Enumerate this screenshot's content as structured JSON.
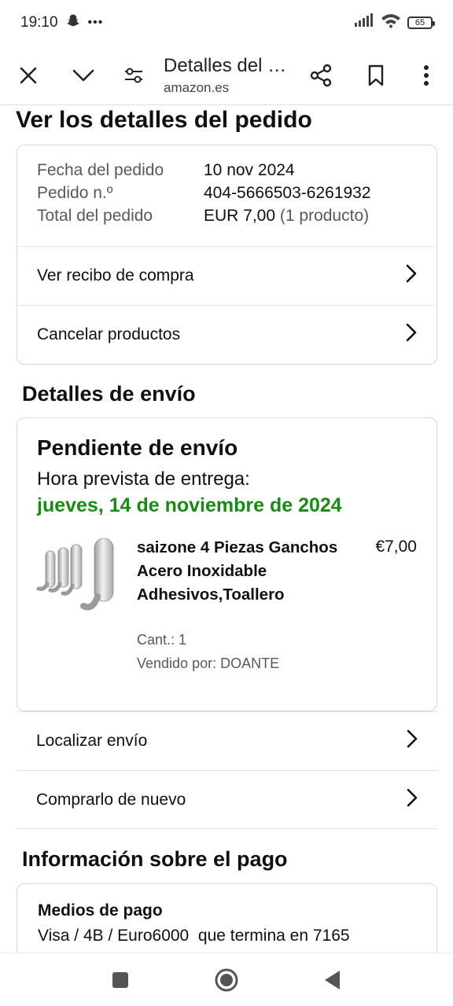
{
  "status_bar": {
    "time": "19:10",
    "dots": "•••",
    "battery": "65"
  },
  "toolbar": {
    "title": "Detalles del …",
    "url": "amazon.es"
  },
  "page": {
    "title": "Ver los detalles del pedido"
  },
  "order_summary": {
    "date_label": "Fecha del pedido",
    "date_value": "10 nov 2024",
    "order_label": "Pedido n.º",
    "order_value": "404-5666503-6261932",
    "total_label": "Total del pedido",
    "total_value": "EUR 7,00",
    "total_items": "(1 producto)",
    "receipt_link": "Ver recibo de compra",
    "cancel_link": "Cancelar productos"
  },
  "shipping": {
    "section_title": "Detalles de envío",
    "status": "Pendiente de envío",
    "eta_label": "Hora prevista de entrega:",
    "eta_date": "jueves, 14 de noviembre de 2024",
    "product": {
      "name": "saizone 4 Piezas Ganchos Acero Inoxidable Adhesivos,Toallero",
      "price": "€7,00",
      "quantity": "Cant.: 1",
      "seller": "Vendido por: DOANTE"
    },
    "track_link": "Localizar envío",
    "buy_again_link": "Comprarlo de nuevo"
  },
  "payment": {
    "section_title": "Información sobre el pago",
    "methods_title": "Medios de pago",
    "method": "Visa / 4B / Euro6000  que termina en 7165"
  },
  "colors": {
    "eta_green": "#1a8a16",
    "border": "#d5d9d9",
    "muted_text": "#565959"
  },
  "icons": [
    "close-icon",
    "chevron-down-icon",
    "tune-icon",
    "share-icon",
    "bookmark-icon",
    "more-vert-icon",
    "chevron-right-icon",
    "nav-square-icon",
    "nav-home-icon",
    "nav-back-icon"
  ]
}
